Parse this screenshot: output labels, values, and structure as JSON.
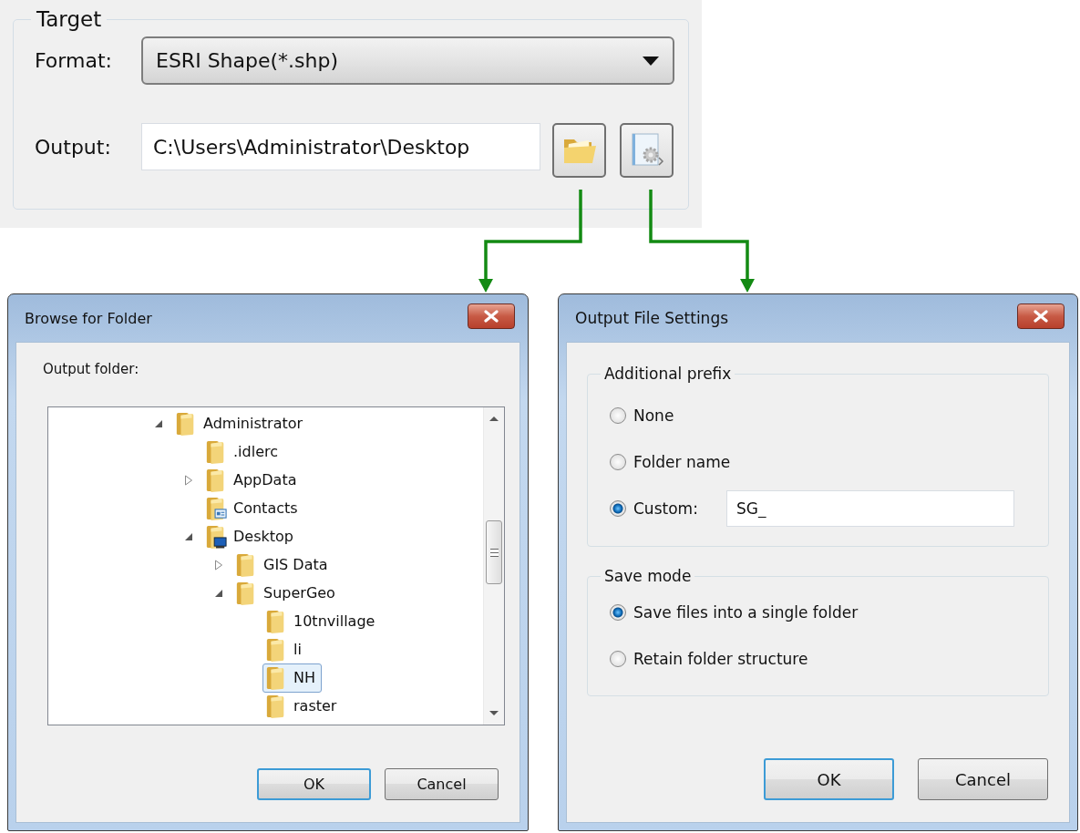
{
  "target_panel": {
    "title": "Target",
    "format_label": "Format:",
    "format_value": "ESRI Shape(*.shp)",
    "output_label": "Output:",
    "output_value": "C:\\Users\\Administrator\\Desktop"
  },
  "browse_dialog": {
    "title": "Browse for Folder",
    "prompt": "Output folder:",
    "tree": [
      {
        "label": "Administrator",
        "kind": "folder",
        "expanded": true,
        "selected": false,
        "children": [
          {
            "label": ".idlerc",
            "kind": "folder",
            "selected": false
          },
          {
            "label": "AppData",
            "kind": "folder",
            "expanded": false,
            "selected": false
          },
          {
            "label": "Contacts",
            "kind": "contacts",
            "selected": false
          },
          {
            "label": "Desktop",
            "kind": "desktop",
            "expanded": true,
            "selected": false,
            "children": [
              {
                "label": "GIS Data",
                "kind": "folder",
                "expanded": false,
                "selected": false
              },
              {
                "label": "SuperGeo",
                "kind": "folder",
                "expanded": true,
                "selected": false,
                "children": [
                  {
                    "label": "10tnvillage",
                    "kind": "folder",
                    "selected": false
                  },
                  {
                    "label": "li",
                    "kind": "folder",
                    "selected": false
                  },
                  {
                    "label": "NH",
                    "kind": "folder",
                    "selected": true
                  },
                  {
                    "label": "raster",
                    "kind": "folder",
                    "selected": false
                  }
                ]
              }
            ]
          }
        ]
      }
    ],
    "buttons": [
      {
        "label": "OK",
        "default": true
      },
      {
        "label": "Cancel",
        "default": false
      }
    ]
  },
  "settings_dialog": {
    "title": "Output File Settings",
    "groups": [
      {
        "title": "Additional prefix",
        "options": [
          {
            "label": "None",
            "selected": false
          },
          {
            "label": "Folder name",
            "selected": false
          },
          {
            "label": "Custom:",
            "selected": true,
            "field_value": "SG_"
          }
        ]
      },
      {
        "title": "Save mode",
        "options": [
          {
            "label": "Save files into a single folder",
            "selected": true
          },
          {
            "label": "Retain folder structure",
            "selected": false
          }
        ]
      }
    ],
    "buttons": [
      {
        "label": "OK",
        "default": true
      },
      {
        "label": "Cancel",
        "default": false
      }
    ]
  }
}
